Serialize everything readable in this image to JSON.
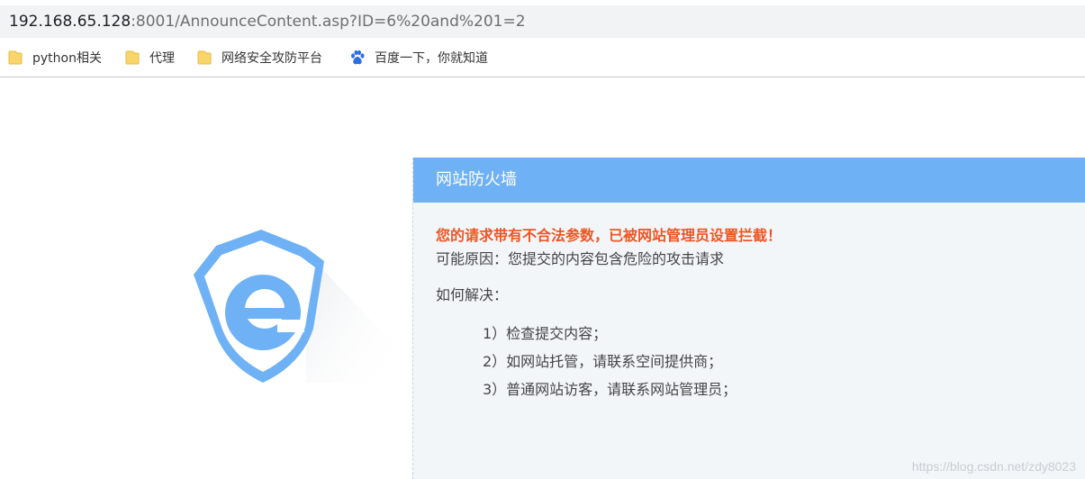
{
  "address_bar": {
    "host": "192.168.65.128",
    "rest": ":8001/AnnounceContent.asp?ID=6%20and%201=2"
  },
  "bookmarks": [
    {
      "label": "python相关",
      "icon": "folder-icon"
    },
    {
      "label": "代理",
      "icon": "folder-icon"
    },
    {
      "label": "网络安全攻防平台",
      "icon": "folder-icon"
    },
    {
      "label": "百度一下，你就知道",
      "icon": "baidu-paw-icon"
    }
  ],
  "panel": {
    "title": "网站防火墙",
    "warning": "您的请求带有不合法参数，已被网站管理员设置拦截！",
    "reason": "可能原因：您提交的内容包含危险的攻击请求",
    "howto": "如何解决：",
    "steps": [
      "1）检查提交内容；",
      "2）如网站托管，请联系空间提供商；",
      "3）普通网站访客，请联系网站管理员；"
    ]
  },
  "watermark": "https://blog.csdn.net/zdy8023",
  "colors": {
    "header_blue": "#6eb1f4",
    "warning_orange": "#ee5522",
    "panel_bg": "#f3f6f9",
    "folder_yellow": "#f9d66b",
    "baidu_blue": "#2d6ee0"
  }
}
